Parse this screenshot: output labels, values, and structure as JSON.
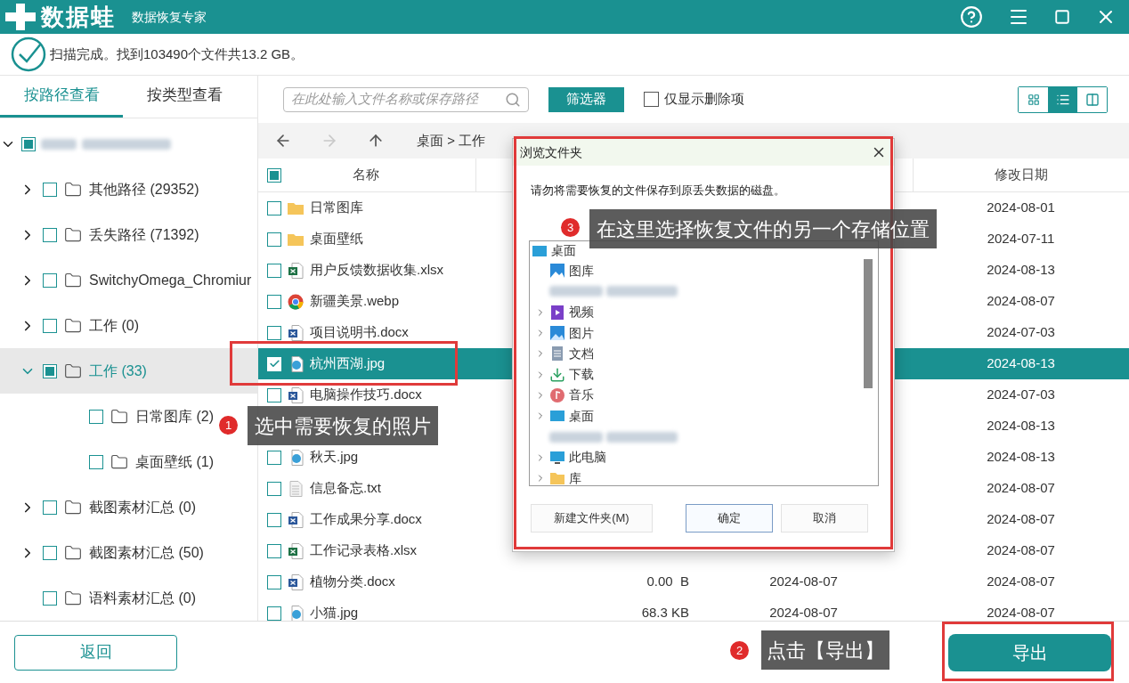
{
  "app": {
    "logo_text": "数据蛙",
    "subtitle": "数据恢复专家"
  },
  "scan_status": "扫描完成。找到103490个文件共13.2 GB。",
  "view_tabs": [
    {
      "label": "按路径查看",
      "selected": true
    },
    {
      "label": "按类型查看",
      "selected": false
    }
  ],
  "tree": {
    "expanded": true,
    "checked": false,
    "partial": true,
    "children": [
      {
        "label": "其他路径 (29352)",
        "expandable": true,
        "expanded": false,
        "checked": false,
        "partial": false,
        "selected": false
      },
      {
        "label": "丢失路径 (71392)",
        "expandable": true,
        "expanded": false,
        "checked": false,
        "partial": false,
        "selected": false
      },
      {
        "label": "SwitchyOmega_Chromiur",
        "expandable": true,
        "expanded": false,
        "checked": false,
        "partial": false,
        "selected": false
      },
      {
        "label": "工作 (0)",
        "expandable": true,
        "expanded": false,
        "checked": false,
        "partial": false,
        "selected": false
      },
      {
        "label": "工作 (33)",
        "expandable": true,
        "expanded": true,
        "checked": false,
        "partial": true,
        "selected": true,
        "children": [
          {
            "label": "日常图库 (2)",
            "expandable": false,
            "checked": false,
            "partial": false,
            "selected": false
          },
          {
            "label": "桌面壁纸 (1)",
            "expandable": false,
            "checked": false,
            "partial": false,
            "selected": false
          }
        ]
      },
      {
        "label": "截图素材汇总 (0)",
        "expandable": true,
        "expanded": false,
        "checked": false,
        "partial": false,
        "selected": false
      },
      {
        "label": "截图素材汇总 (50)",
        "expandable": true,
        "expanded": false,
        "checked": false,
        "partial": false,
        "selected": false
      },
      {
        "label": "语料素材汇总 (0)",
        "expandable": false,
        "checked": false,
        "partial": false,
        "selected": false
      }
    ]
  },
  "search": {
    "placeholder": "在此处输入文件名称或保存路径"
  },
  "filter_button": "筛选器",
  "deleted_only": {
    "label": "仅显示删除项",
    "checked": false
  },
  "view_modes": [
    {
      "kind": "grid",
      "selected": false
    },
    {
      "kind": "list",
      "selected": true
    },
    {
      "kind": "columns",
      "selected": false
    }
  ],
  "nav_buttons": [
    {
      "kind": "back",
      "disabled": false
    },
    {
      "kind": "forward",
      "disabled": true
    },
    {
      "kind": "up",
      "disabled": false
    }
  ],
  "breadcrumb": "桌面 > 工作",
  "table": {
    "checked": false,
    "partial": true,
    "columns": [
      "名称",
      "修改日期"
    ],
    "rows": [
      {
        "name": "日常图库",
        "kind": "folder",
        "checked": false,
        "selected": false,
        "modified": "2024-08-01"
      },
      {
        "name": "桌面壁纸",
        "kind": "folder",
        "checked": false,
        "selected": false,
        "modified": "2024-07-11"
      },
      {
        "name": "用户反馈数据收集.xlsx",
        "kind": "excel",
        "checked": false,
        "selected": false,
        "modified": "2024-08-13"
      },
      {
        "name": "新疆美景.webp",
        "kind": "chrome",
        "checked": false,
        "selected": false,
        "modified": "2024-08-07"
      },
      {
        "name": "项目说明书.docx",
        "kind": "word",
        "checked": false,
        "selected": false,
        "modified": "2024-07-03"
      },
      {
        "name": "杭州西湖.jpg",
        "kind": "image",
        "checked": true,
        "selected": true,
        "modified": "2024-08-13"
      },
      {
        "name": "电脑操作技巧.docx",
        "kind": "word",
        "checked": false,
        "selected": false,
        "modified": "2024-07-03"
      },
      {
        "modified": "2024-08-13"
      },
      {
        "name": "秋天.jpg",
        "kind": "image",
        "checked": false,
        "selected": false,
        "modified": "2024-08-13"
      },
      {
        "name": "信息备忘.txt",
        "kind": "text",
        "checked": false,
        "selected": false,
        "modified": "2024-08-07"
      },
      {
        "name": "工作成果分享.docx",
        "kind": "word",
        "checked": false,
        "selected": false,
        "modified": "2024-08-07"
      },
      {
        "name": "工作记录表格.xlsx",
        "kind": "excel",
        "checked": false,
        "selected": false,
        "modified": "2024-08-07"
      },
      {
        "name": "植物分类.docx",
        "kind": "word",
        "checked": false,
        "selected": false,
        "column_2": "0.00  B",
        "column_3": "2024-08-07",
        "modified": "2024-08-07"
      },
      {
        "name": "小猫.jpg",
        "kind": "image",
        "checked": false,
        "selected": false,
        "column_2": "68.3 KB",
        "column_3": "2024-08-07",
        "modified": "2024-08-07"
      }
    ]
  },
  "back_button": "返回",
  "export_button": "导出",
  "dialog": {
    "title": "浏览文件夹",
    "message": "请勿将需要恢复的文件保存到原丢失数据的磁盘。",
    "tree": {
      "label": "桌面",
      "kind": "desktop",
      "children": [
        {
          "label": "图库",
          "kind": "gallery",
          "expandable": false
        },
        {
          "kind": "redacted"
        },
        {
          "label": "视频",
          "kind": "video",
          "expandable": true
        },
        {
          "label": "图片",
          "kind": "pictures",
          "expandable": true
        },
        {
          "label": "文档",
          "kind": "documents",
          "expandable": true
        },
        {
          "label": "下载",
          "kind": "download",
          "expandable": true
        },
        {
          "label": "音乐",
          "kind": "music",
          "expandable": true
        },
        {
          "label": "桌面",
          "kind": "desktop",
          "expandable": true
        },
        {
          "kind": "redacted"
        },
        {
          "label": "此电脑",
          "kind": "computer",
          "expandable": true
        },
        {
          "label": "库",
          "kind": "library",
          "expandable": true
        }
      ]
    },
    "buttons": [
      {
        "label": "新建文件夹(M)",
        "default": false
      },
      {
        "label": "确定",
        "default": true
      },
      {
        "label": "取消",
        "default": false
      }
    ]
  },
  "callouts": [
    {
      "number": "3",
      "text": "在这里选择恢复文件的另一个存储位置"
    },
    {
      "number": "1",
      "text": "选中需要恢复的照片"
    },
    {
      "number": "2",
      "text": "点击【导出】"
    }
  ]
}
